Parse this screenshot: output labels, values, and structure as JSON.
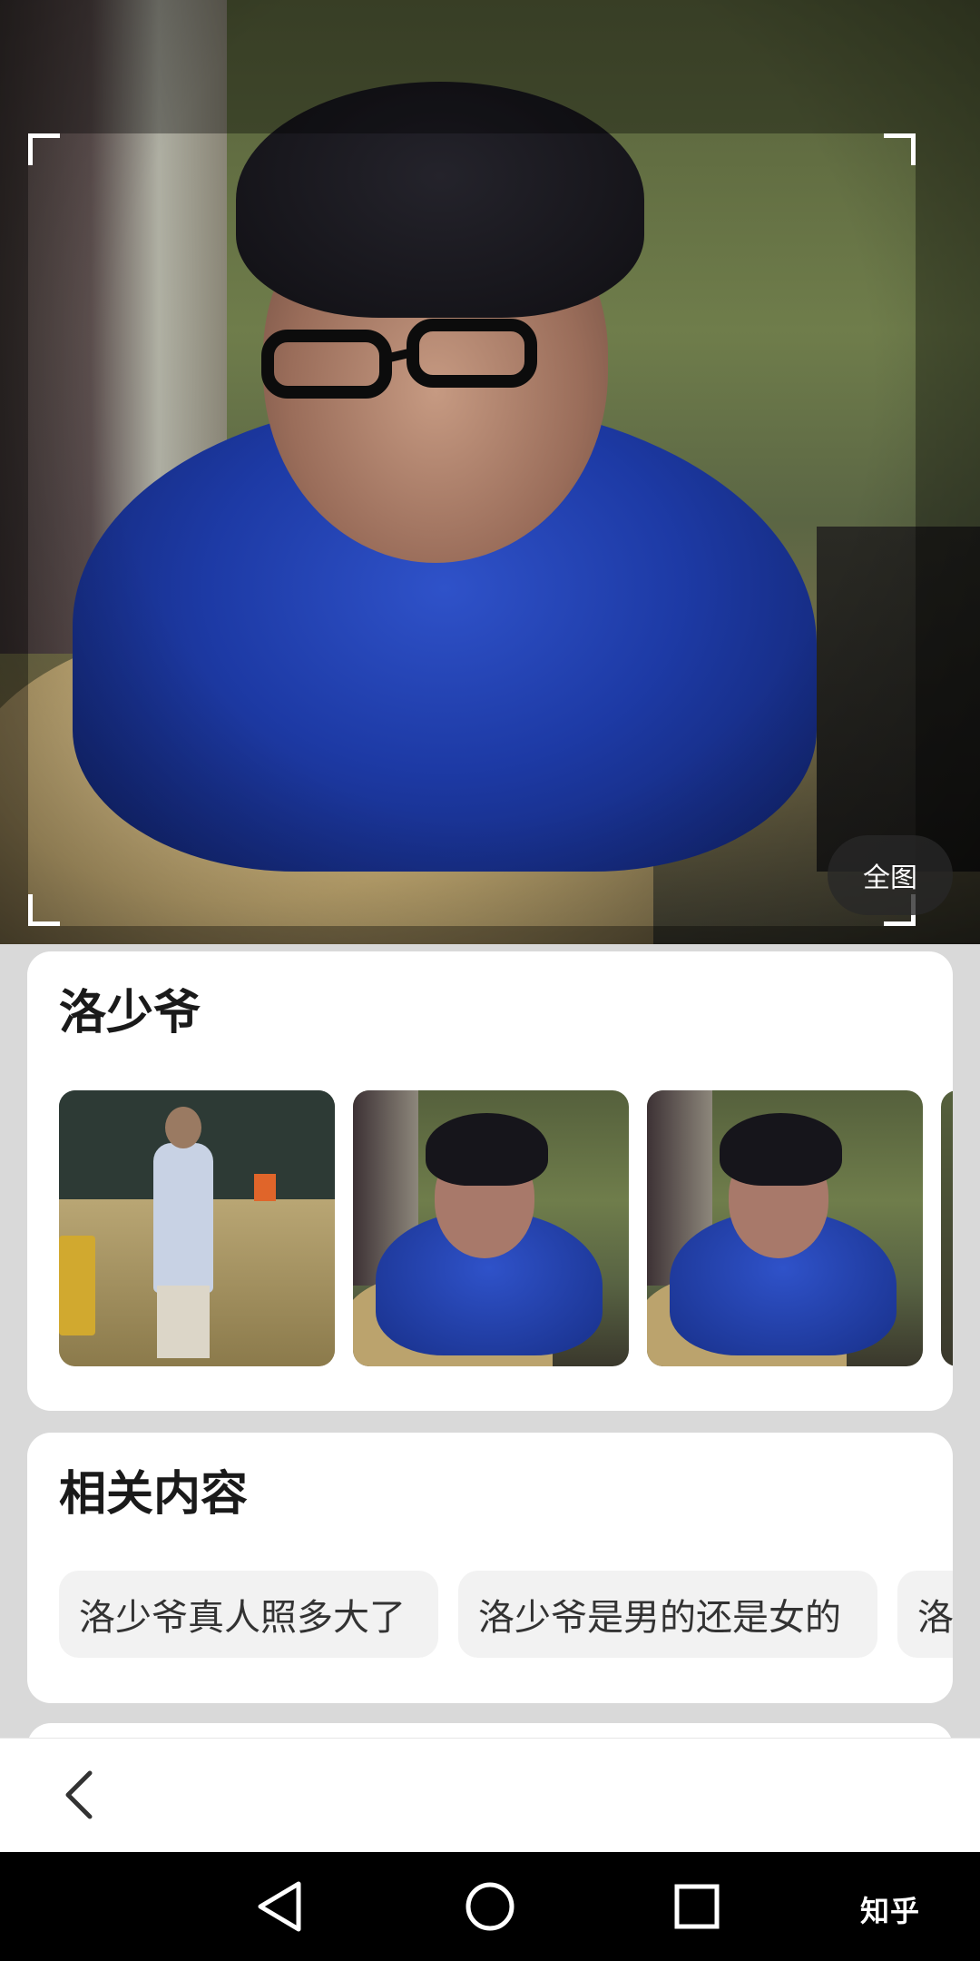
{
  "hero": {
    "full_image_label": "全图"
  },
  "result_card": {
    "title": "洛少爷",
    "thumbnails": [
      {
        "name": "thumb-1"
      },
      {
        "name": "thumb-2"
      },
      {
        "name": "thumb-3"
      },
      {
        "name": "thumb-4"
      }
    ]
  },
  "related_card": {
    "title": "相关内容",
    "chips": [
      "洛少爷真人照多大了",
      "洛少爷是男的还是女的",
      "洛"
    ]
  },
  "bottom_bar": {
    "back_icon": "chevron-left-icon"
  },
  "system_nav": {
    "back_icon": "triangle-back-icon",
    "home_icon": "circle-home-icon",
    "recent_icon": "square-recent-icon",
    "watermark": "知乎"
  }
}
